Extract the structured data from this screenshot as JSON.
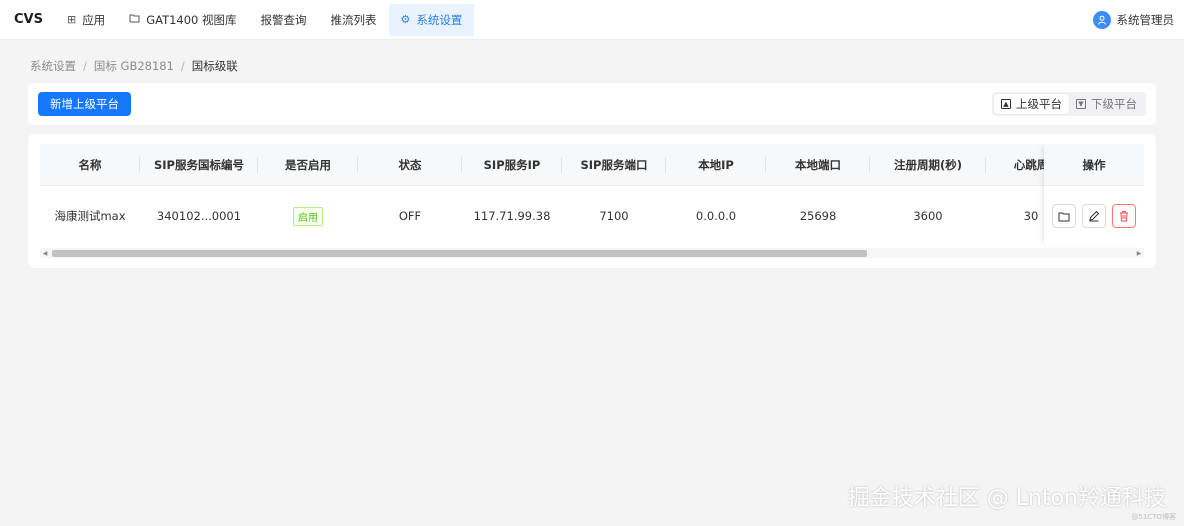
{
  "nav": {
    "brand": "CVS",
    "items": [
      {
        "label": "应用",
        "icon": "grid-icon"
      },
      {
        "label": "GAT1400 视图库",
        "icon": "folder-icon"
      },
      {
        "label": "报警查询"
      },
      {
        "label": "推流列表"
      },
      {
        "label": "系统设置",
        "icon": "gear-icon",
        "active": true
      }
    ],
    "user": "系统管理员"
  },
  "breadcrumb": [
    "系统设置",
    "国标 GB28181",
    "国标级联"
  ],
  "toolbar": {
    "add_label": "新增上级平台",
    "segments": [
      {
        "label": "上级平台",
        "active": true
      },
      {
        "label": "下级平台",
        "active": false
      }
    ]
  },
  "table": {
    "columns": [
      "名称",
      "SIP服务国标编号",
      "是否启用",
      "状态",
      "SIP服务IP",
      "SIP服务端口",
      "本地IP",
      "本地端口",
      "注册周期(秒)",
      "心跳周",
      "操作"
    ],
    "rows": [
      {
        "name": "海康测试max",
        "sip_id": "340102...0001",
        "enabled": "启用",
        "status": "OFF",
        "sip_ip": "117.71.99.38",
        "sip_port": "7100",
        "local_ip": "0.0.0.0",
        "local_port": "25698",
        "register_period": "3600",
        "heartbeat": "30"
      }
    ]
  },
  "colors": {
    "primary": "#1677ff",
    "danger": "#ff4d4f",
    "success": "#52c41a"
  },
  "watermark": {
    "main": "掘金技术社区 @ Lnton羚通科技",
    "sub": "@51CTO博客"
  }
}
